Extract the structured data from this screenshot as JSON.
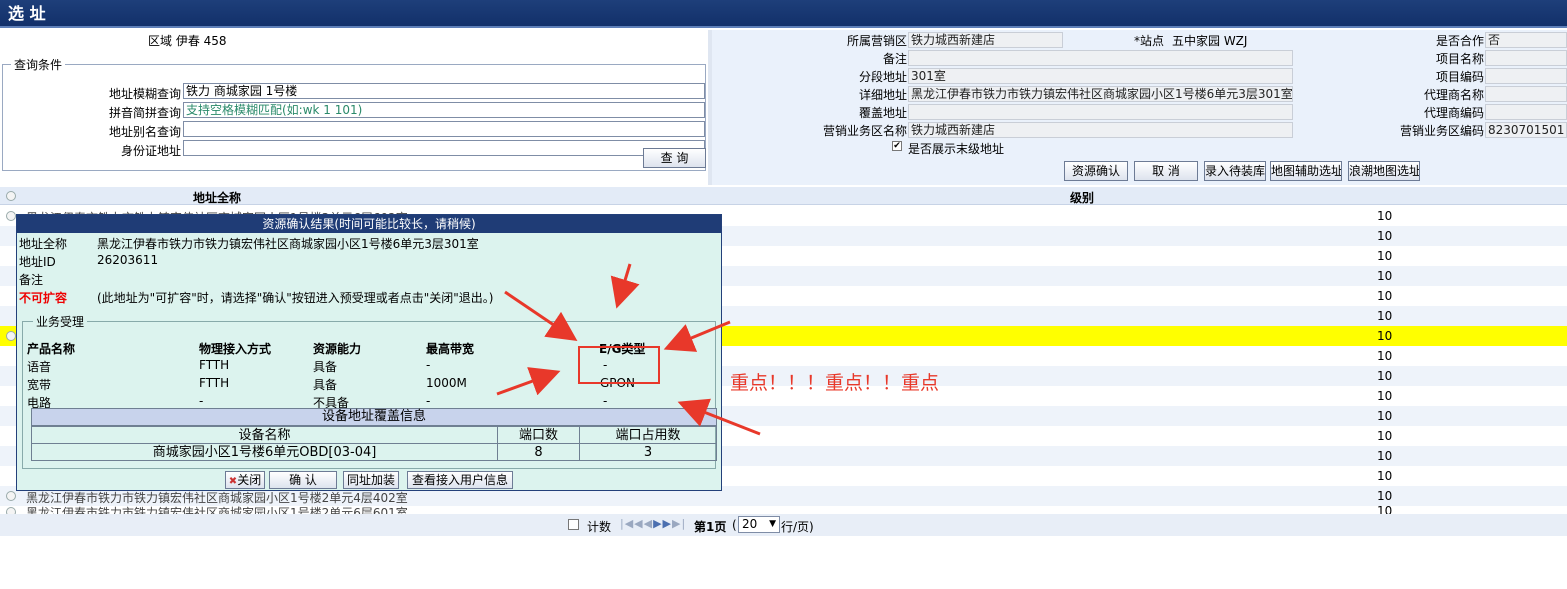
{
  "title": "选 址",
  "left": {
    "region_label": "区域",
    "region_value": "伊春 458",
    "query_legend": "查询条件",
    "fields": [
      {
        "label": "地址模糊查询",
        "value": "铁力 商城家园 1号楼"
      },
      {
        "label": "拼音简拼查询",
        "value": "支持空格模糊匹配(如:wk 1 101)"
      },
      {
        "label": "地址别名查询",
        "value": ""
      },
      {
        "label": "身份证地址",
        "value": ""
      }
    ],
    "search_button": "查 询"
  },
  "right": {
    "sales_area_label": "所属营销区",
    "sales_area_value": "铁力城西新建店",
    "station_label": "*站点",
    "station_value": "五中家园 WZJ",
    "coop_label": "是否合作",
    "coop_value": "否",
    "remark_label": "备注",
    "project_name_label": "项目名称",
    "segment_label": "分段地址",
    "segment_value": "301室",
    "project_code_label": "项目编码",
    "detail_label": "详细地址",
    "detail_value": "黑龙江伊春市铁力市铁力镇宏伟社区商城家园小区1号楼6单元3层301室",
    "agent_name_label": "代理商名称",
    "cover_label": "覆盖地址",
    "agent_code_label": "代理商编码",
    "biz_area_name_label": "营销业务区名称",
    "biz_area_name_value": "铁力城西新建店",
    "biz_area_code_label": "营销业务区编码",
    "biz_area_code_value": "8230701501",
    "show_last_label": "是否展示末级地址",
    "buttons": [
      "资源确认",
      "取 消",
      "录入待装库",
      "地图辅助选址",
      "浪潮地图选址"
    ]
  },
  "grid": {
    "col_addr": "地址全称",
    "col_level": "级别",
    "levels": [
      "10",
      "10",
      "10",
      "10",
      "10",
      "10",
      "10",
      "10",
      "10",
      "10",
      "10",
      "10",
      "10",
      "10",
      "10",
      "10"
    ],
    "row_first_addr": "黑龙江伊春市铁力市铁力镇宏伟社区商城家园小区1号楼3单元6层602室",
    "row_a_addr": "黑龙江伊春市铁力市铁力镇宏伟社区商城家园小区1号楼2单元4层402室",
    "row_b_addr": "黑龙江伊春市铁力市铁力镇宏伟社区商城家园小区1号楼2单元6层601室"
  },
  "pager": {
    "count_label": "计数",
    "page_label": "第1页",
    "page_size": "20",
    "per_page": "行/页)"
  },
  "dialog": {
    "title": "资源确认结果(时间可能比较长，请稍候)",
    "addr_label": "地址全称",
    "addr_value": "黑龙江伊春市铁力市铁力镇宏伟社区商城家园小区1号楼6单元3层301室",
    "id_label": "地址ID",
    "id_value": "26203611",
    "remark_label": "备注",
    "ext_label": "不可扩容",
    "ext_note": "(此地址为\"可扩容\"时，请选择\"确认\"按钮进入预受理或者点击\"关闭\"退出。)",
    "biz_legend": "业务受理",
    "headers": [
      "产品名称",
      "物理接入方式",
      "资源能力",
      "最高带宽",
      "E/G类型"
    ],
    "rows": [
      [
        "语音",
        "FTTH",
        "具备",
        "-",
        "-"
      ],
      [
        "宽带",
        "FTTH",
        "具备",
        "1000M",
        "GPON"
      ],
      [
        "电路",
        "-",
        "不具备",
        "-",
        "-"
      ]
    ],
    "dev_title": "设备地址覆盖信息",
    "dev_headers": [
      "设备名称",
      "端口数",
      "端口占用数"
    ],
    "dev_row": [
      "商城家园小区1号楼6单元OBD[03-04]",
      "8",
      "3"
    ],
    "buttons": [
      "关闭",
      "确 认",
      "同址加装",
      "查看接入用户信息"
    ]
  },
  "annotation": "重点！！！重点！！重点",
  "colors": {
    "title_bg": "#12306a",
    "highlight_row": "#ffff00",
    "annotation": "#e8382a",
    "dialog_bg": "#dcf3ee"
  }
}
